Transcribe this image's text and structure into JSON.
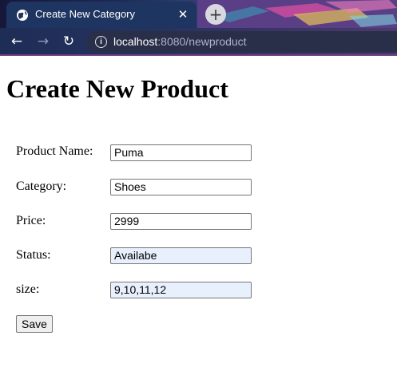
{
  "browser": {
    "tab_title": "Create New Category",
    "tab_close": "✕",
    "new_tab": "+",
    "url_host": "localhost",
    "url_path": ":8080/newproduct"
  },
  "page": {
    "heading": "Create New Product",
    "fields": [
      {
        "label": "Product Name:",
        "value": "Puma"
      },
      {
        "label": "Category:",
        "value": "Shoes"
      },
      {
        "label": "Price:",
        "value": "2999"
      },
      {
        "label": "Status:",
        "value": "Availabe"
      },
      {
        "label": "size:",
        "value": "9,10,11,12"
      }
    ],
    "save_label": "Save"
  }
}
